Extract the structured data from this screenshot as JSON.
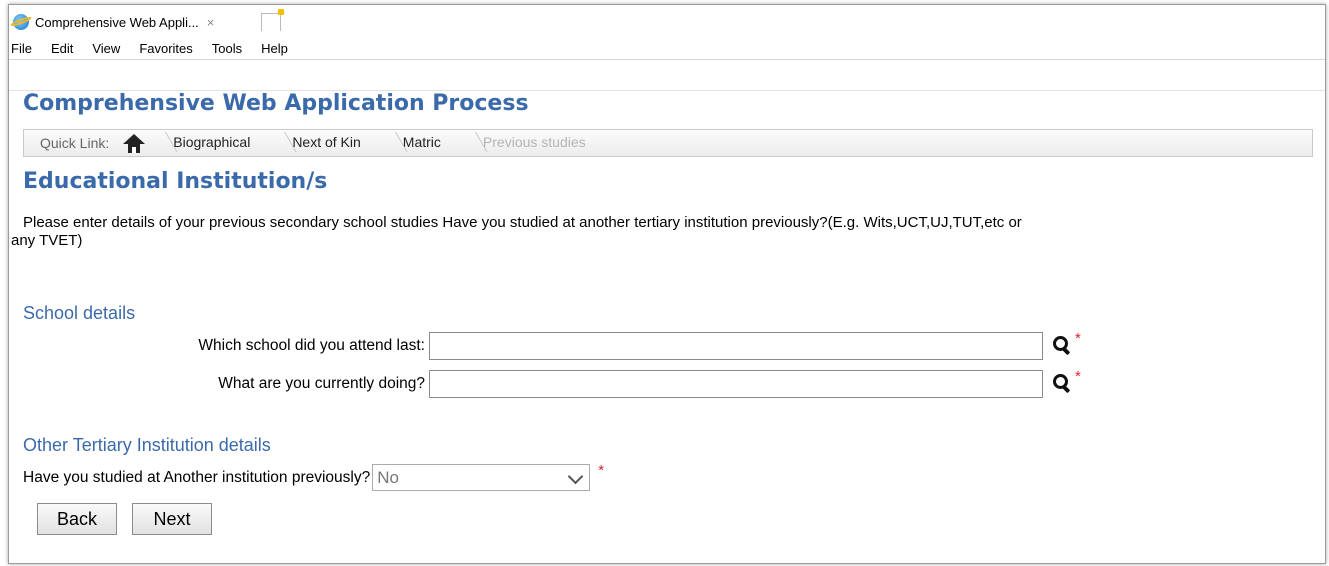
{
  "browser": {
    "tab_title": "Comprehensive Web Appli...",
    "tab_close": "×",
    "menu": [
      "File",
      "Edit",
      "View",
      "Favorites",
      "Tools",
      "Help"
    ]
  },
  "app_title": "Comprehensive Web Application Process",
  "quick_links": {
    "label": "Quick Link:",
    "items": [
      {
        "label": "Biographical",
        "enabled": true
      },
      {
        "label": "Next of Kin",
        "enabled": true
      },
      {
        "label": "Matric",
        "enabled": true
      },
      {
        "label": "Previous studies",
        "enabled": false
      }
    ]
  },
  "section_title": "Educational Institution/s",
  "instructions": {
    "line1": "Please enter details of your previous secondary school studies Have you studied at another tertiary institution previously?(E.g. Wits,UCT,UJ,TUT,etc or",
    "line2": "any TVET)"
  },
  "school_details": {
    "heading": "School details",
    "school_label": "Which school did you attend last:",
    "school_value": "",
    "doing_label": "What are you currently doing?",
    "doing_value": ""
  },
  "tertiary_details": {
    "heading": "Other Tertiary Institution details",
    "studied_label": "Have you studied at Another institution previously?",
    "studied_value": "No"
  },
  "required_marker": "*",
  "buttons": {
    "back": "Back",
    "next": "Next"
  },
  "colors": {
    "heading": "#3b6aab",
    "required": "#e0242a"
  }
}
